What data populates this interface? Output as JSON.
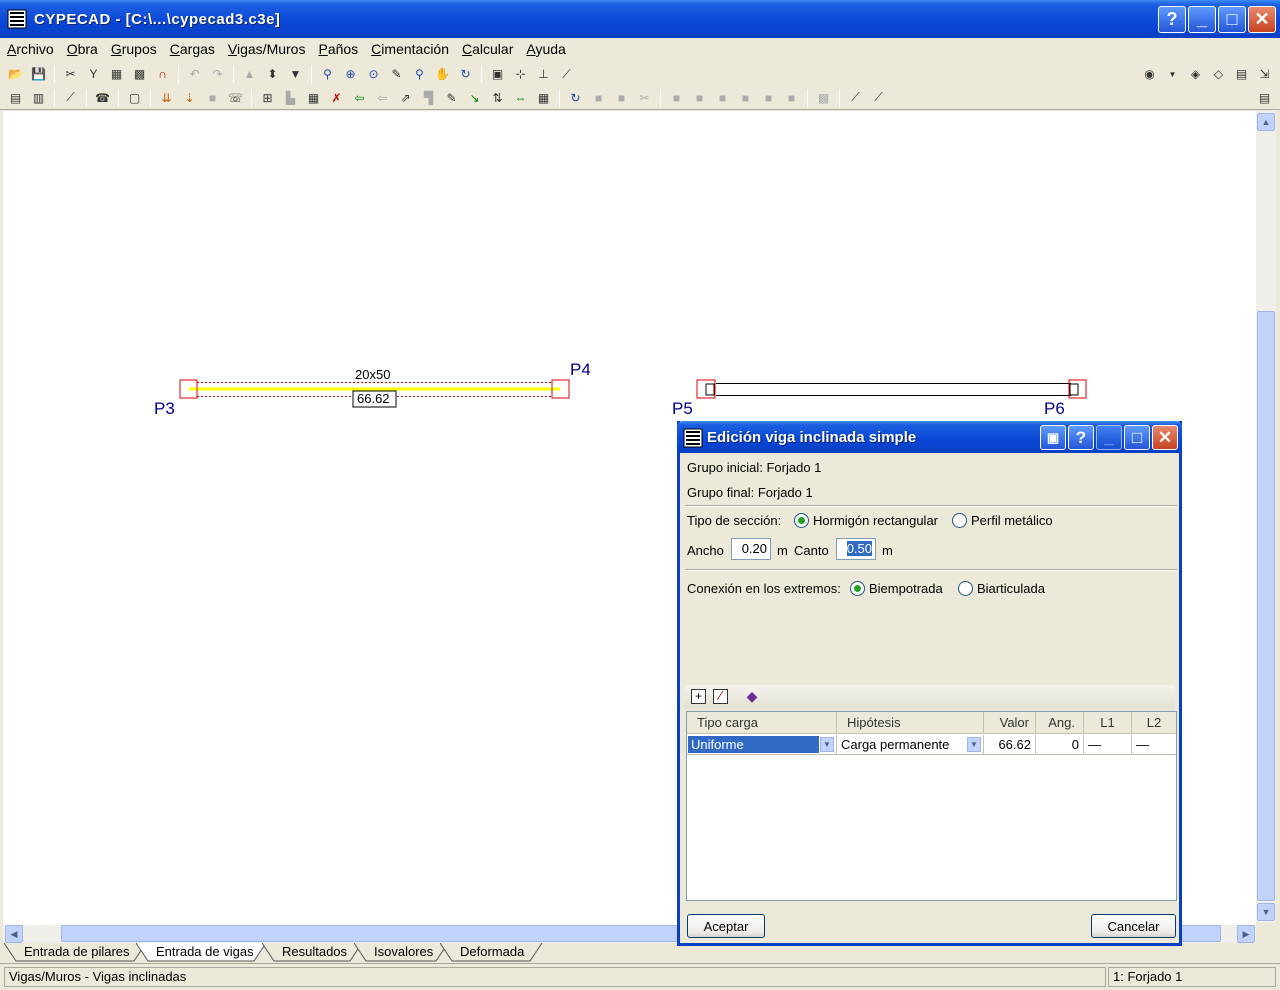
{
  "window": {
    "title": "CYPECAD - [C:\\...\\cypecad3.c3e]"
  },
  "menu": [
    {
      "u": "A",
      "rest": "rchivo"
    },
    {
      "u": "O",
      "rest": "bra"
    },
    {
      "u": "G",
      "rest": "rupos"
    },
    {
      "u": "C",
      "rest": "argas"
    },
    {
      "u": "V",
      "rest": "igas/Muros"
    },
    {
      "u": "P",
      "rest": "años"
    },
    {
      "u": "C",
      "rest": "imentación"
    },
    {
      "u": "C",
      "rest": "alcular"
    },
    {
      "u": "A",
      "rest": "yuda"
    }
  ],
  "drawing": {
    "beam1": {
      "section": "20x50",
      "value": "66.62",
      "start": "P3",
      "end": "P4"
    },
    "beam2": {
      "start": "P5",
      "end": "P6"
    }
  },
  "dialog": {
    "title": "Edición viga inclinada simple",
    "grupo_inicial": "Grupo inicial: Forjado 1",
    "grupo_final": "Grupo final: Forjado 1",
    "tipo_seccion_label": "Tipo de sección:",
    "opt_hormigon": "Hormigón rectangular",
    "opt_perfil": "Perfil metálico",
    "ancho_label": "Ancho",
    "ancho_value": "0.20",
    "unit_m": "m",
    "canto_label": "Canto",
    "canto_value": "0.50",
    "conexion_label": "Conexión en los extremos:",
    "opt_biempotrada": "Biempotrada",
    "opt_biarticulada": "Biarticulada",
    "table": {
      "headers": [
        "Tipo carga",
        "Hipótesis",
        "Valor",
        "Ang.",
        "L1",
        "L2"
      ],
      "rows": [
        {
          "tipo": "Uniforme",
          "hipotesis": "Carga permanente",
          "valor": "66.62",
          "ang": "0",
          "l1": "—",
          "l2": "—"
        }
      ]
    },
    "accept": "Aceptar",
    "cancel": "Cancelar"
  },
  "tabs": [
    "Entrada de pilares",
    "Entrada de vigas",
    "Resultados",
    "Isovalores",
    "Deformada"
  ],
  "active_tab": "Entrada de vigas",
  "status": {
    "left": "Vigas/Muros - Vigas inclinadas",
    "right": "1: Forjado 1"
  },
  "colors": {
    "title_blue": "#0A46D6",
    "beam_yellow": "#FFFF00",
    "column_red": "#DD0000",
    "label_navy": "#00008B",
    "radio_green": "#21A121"
  }
}
